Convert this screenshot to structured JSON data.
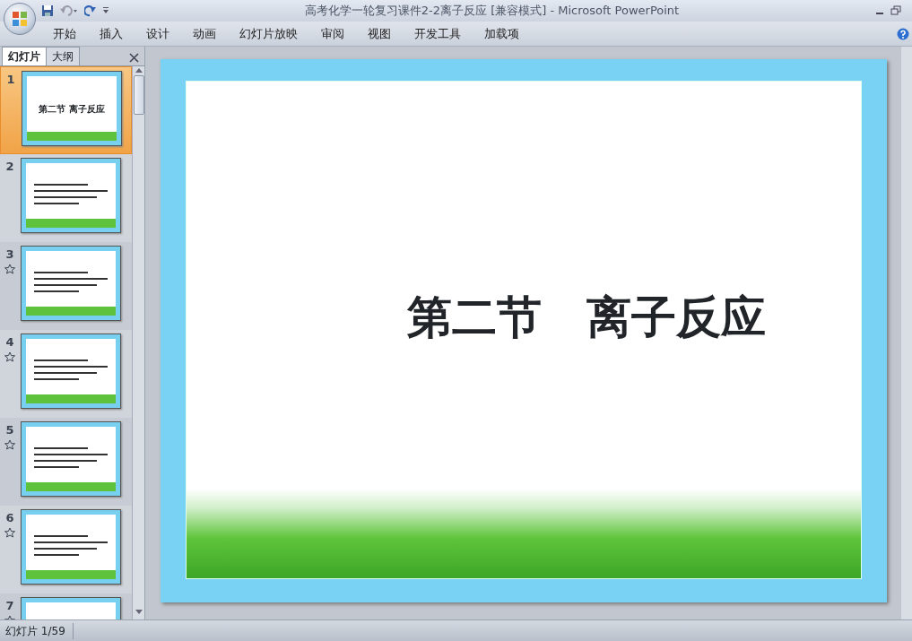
{
  "window": {
    "title": "高考化学一轮复习课件2-2离子反应 [兼容模式] - Microsoft PowerPoint"
  },
  "ribbon_tabs": [
    "开始",
    "插入",
    "设计",
    "动画",
    "幻灯片放映",
    "审阅",
    "视图",
    "开发工具",
    "加载项"
  ],
  "pane_tabs": [
    {
      "label": "幻灯片",
      "selected": true
    },
    {
      "label": "大纲",
      "selected": false
    }
  ],
  "slides": [
    {
      "number": "1",
      "selected": true,
      "animated": false,
      "title": "第二节  离子反应"
    },
    {
      "number": "2",
      "selected": false,
      "animated": false
    },
    {
      "number": "3",
      "selected": false,
      "animated": true
    },
    {
      "number": "4",
      "selected": false,
      "animated": true
    },
    {
      "number": "5",
      "selected": false,
      "animated": true
    },
    {
      "number": "6",
      "selected": false,
      "animated": true
    },
    {
      "number": "7",
      "selected": false,
      "animated": true
    }
  ],
  "current_slide": {
    "title": "第二节　离子反应"
  },
  "status_bar": {
    "slide_counter": "幻灯片 1/59"
  }
}
